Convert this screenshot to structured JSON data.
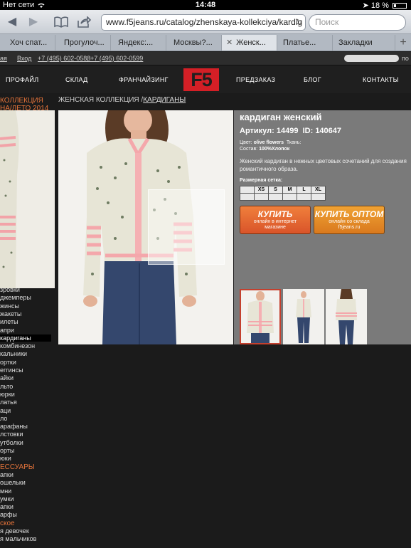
{
  "status": {
    "carrier": "Нет сети",
    "time": "14:48",
    "battery": "18 %"
  },
  "browser": {
    "url": "www.f5jeans.ru/catalog/zhenskaya-kollekciya/kardig",
    "search_placeholder": "Поиск",
    "tabs": [
      {
        "label": "Хоч спат..."
      },
      {
        "label": "Прогулоч..."
      },
      {
        "label": "Яндекс:..."
      },
      {
        "label": "Москвы?..."
      },
      {
        "label": "Женск..."
      },
      {
        "label": "Платье..."
      },
      {
        "label": "Закладки"
      }
    ]
  },
  "utilbar": {
    "link1": "ая",
    "login": "Вход",
    "phone1": "+7 (495) 602-0588",
    "sep": ",",
    "phone2": "+7 (495) 602-0599",
    "search_tail": "по"
  },
  "nav": {
    "items": [
      "ПРОФАЙЛ",
      "СКЛАД",
      "ФРАНЧАЙЗИНГ",
      "ПРЕДЗАКАЗ",
      "БЛОГ",
      "КОНТАКТЫ"
    ],
    "logo": "F5"
  },
  "breadcrumb": {
    "section": "ЖЕНСКАЯ КОЛЛЕКЦИЯ /",
    "current": "КАРДИГАНЫ"
  },
  "sidebar": {
    "heading1": "КОЛЛЕКЦИЯ",
    "heading2": "НА/ЛЕТО 2014",
    "items": [
      "зровки",
      "джемперы",
      "жинсы",
      "жакеты",
      "илеты",
      "апри",
      "кардиганы",
      "комбинезон",
      "кальники",
      "ортки",
      "еггинсы",
      "айки",
      "льто",
      "юрки",
      "латья",
      "аци",
      "ло",
      "арафаны",
      "лстовки",
      "утболки",
      "орты",
      "юки"
    ],
    "selected_index": 6,
    "heading3": "ЕССУАРЫ",
    "items2": [
      "апки",
      "ошельки",
      "мни",
      "умки",
      "апки",
      "арфы"
    ],
    "heading4": "ское",
    "items3": [
      "я девочек",
      "я мальчиков"
    ]
  },
  "product": {
    "title": "кардиган женский",
    "article_label": "Артикул:",
    "article": "14499",
    "id_label": "ID:",
    "id": "140647",
    "color_label": "Цвет:",
    "color": "olive flowers",
    "fabric_label": "Ткань:",
    "composition_label": "Состав:",
    "composition": "100%Хлопок",
    "description": "Женский кардиган в нежных цветовых сочетаний для создания романтичного образа.",
    "size_label": "Размерная сетка:",
    "sizes": [
      "",
      "XS",
      "S",
      "M",
      "L",
      "XL"
    ]
  },
  "buttons": {
    "buy": {
      "title": "КУПИТЬ",
      "sub1": "онлайн в интернет",
      "sub2": "магазине"
    },
    "wholesale": {
      "title": "КУПИТЬ ОПТОМ",
      "sub1": "онлайн со склада",
      "sub2": "f5jeans.ru"
    }
  },
  "colors": {
    "accent": "#e3733a",
    "brand": "#d41f26",
    "panel": "#7a7a7a"
  }
}
